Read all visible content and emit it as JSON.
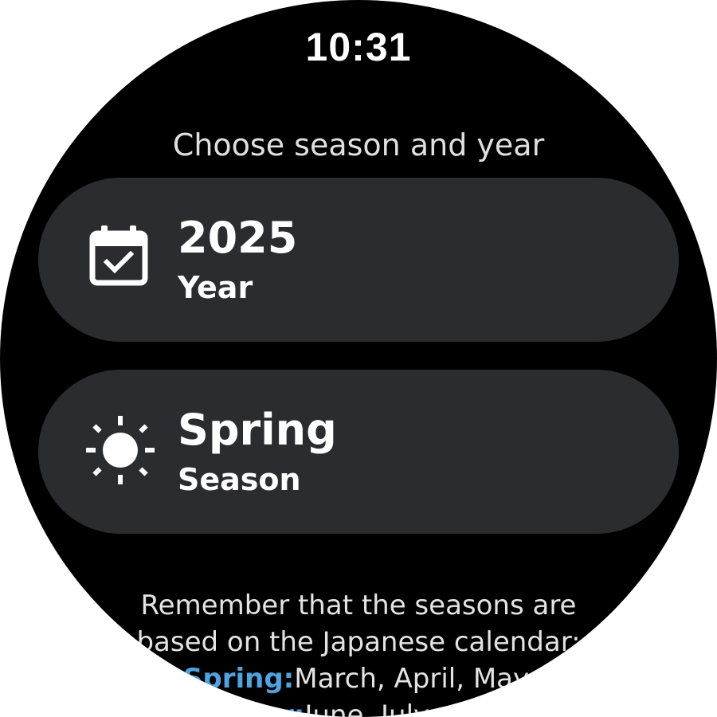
{
  "status_bar": {
    "time": "10:31"
  },
  "header": {
    "title": "Choose season and year"
  },
  "year_chip": {
    "icon": "calendar-check-icon",
    "value": "2025",
    "label": "Year"
  },
  "season_chip": {
    "icon": "sun-icon",
    "value": "Spring",
    "label": "Season"
  },
  "note": {
    "line1": "Remember that the seasons are",
    "line2": "based on the Japanese calendar:",
    "spring_label": "Spring:",
    "spring_months": "March, April, May.",
    "summer_label": "Summer:",
    "summer_months": "June, July, August."
  },
  "colors": {
    "background": "#000000",
    "chip": "#2b2c2f",
    "highlight": "#4ea3e0"
  }
}
